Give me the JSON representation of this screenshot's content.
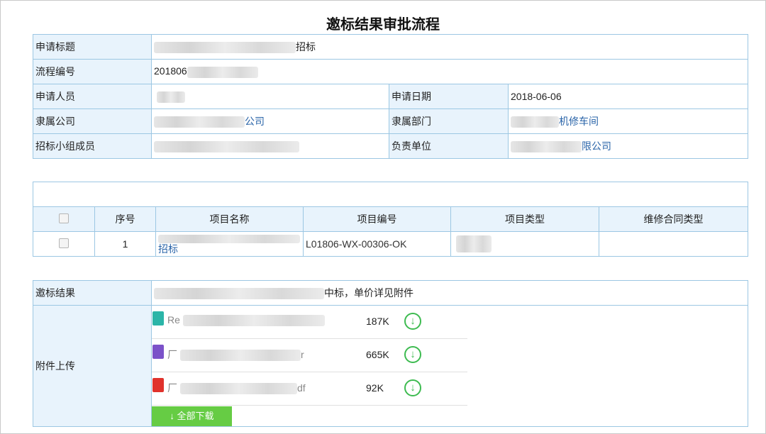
{
  "page_title": "邀标结果审批流程",
  "colors": {
    "accent": "#2a64a8",
    "label_bg": "#e8f3fc",
    "border": "#9cc7e3",
    "download": "#3dbb50",
    "button": "#66cc44"
  },
  "info": {
    "subject_label": "申请标题",
    "subject_value": "招标",
    "flow_no_label": "流程编号",
    "flow_no_value": "201806",
    "applicant_label": "申请人员",
    "apply_date_label": "申请日期",
    "apply_date_value": "2018-06-06",
    "company_label": "隶属公司",
    "company_value": "公司",
    "dept_label": "隶属部门",
    "dept_value": "机修车间",
    "members_label": "招标小组成员",
    "unit_label": "负责单位",
    "unit_value": "限公司"
  },
  "projects": {
    "headers": [
      "序号",
      "项目名称",
      "项目编号",
      "项目类型",
      "维修合同类型"
    ],
    "rows": [
      {
        "index": "1",
        "name": "招标",
        "code": "L01806-WX-00306-OK",
        "type": "",
        "contract_type": ""
      }
    ]
  },
  "result": {
    "result_label": "邀标结果",
    "result_value": "中标，单价详见附件",
    "attach_label": "附件上传",
    "files": [
      {
        "name": "Re",
        "size": "187K",
        "icon": "image-file-icon",
        "color": "#2bb5a8"
      },
      {
        "name": "厂",
        "suffix": "r",
        "size": "665K",
        "icon": "rar-file-icon",
        "color": "#7b52c9"
      },
      {
        "name": "厂",
        "suffix": "df",
        "size": "92K",
        "icon": "pdf-file-icon",
        "color": "#e0322c"
      }
    ],
    "download_all": "全部下载",
    "download_all_icon": "↓"
  }
}
